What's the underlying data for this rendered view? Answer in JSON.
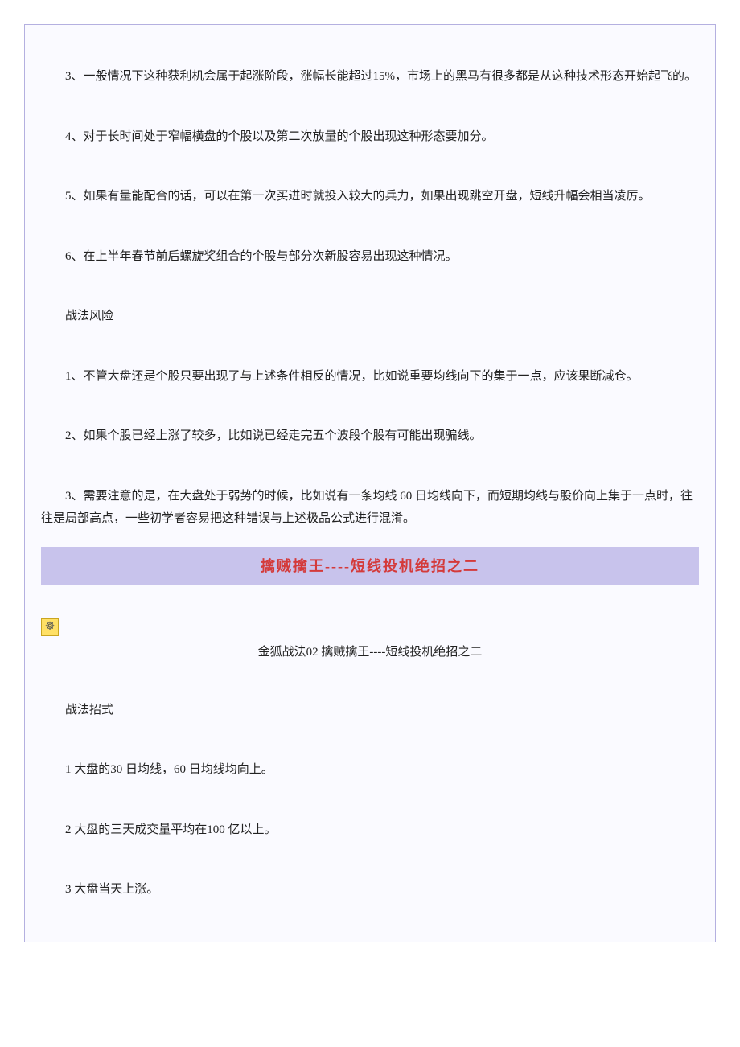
{
  "paragraphs": {
    "p1": "3、一般情况下这种获利机会属于起涨阶段，涨幅长能超过15%，市场上的黑马有很多都是从这种技术形态开始起飞的。",
    "p2": "4、对于长时间处于窄幅横盘的个股以及第二次放量的个股出现这种形态要加分。",
    "p3": "5、如果有量能配合的话，可以在第一次买进时就投入较大的兵力，如果出现跳空开盘，短线升幅会相当凌厉。",
    "p4": "6、在上半年春节前后螺旋奖组合的个股与部分次新股容易出现这种情况。",
    "heading1": "战法风险",
    "p5": "1、不管大盘还是个股只要出现了与上述条件相反的情况，比如说重要均线向下的集于一点，应该果断减仓。",
    "p6": "2、如果个股已经上涨了较多，比如说已经走完五个波段个股有可能出现骗线。",
    "p7": "3、需要注意的是，在大盘处于弱势的时候，比如说有一条均线 60 日均线向下，而短期均线与股价向上集于一点时，往往是局部高点，一些初学者容易把这种错误与上述极品公式进行混淆。"
  },
  "section_title": "擒贼擒王----短线投机绝招之二",
  "icon_char": "☸",
  "subtitle": "金狐战法02 擒贼擒王----短线投机绝招之二",
  "lower": {
    "heading": "战法招式",
    "l1": "1 大盘的30 日均线，60 日均线均向上。",
    "l2": "2 大盘的三天成交量平均在100 亿以上。",
    "l3": "3 大盘当天上涨。"
  }
}
